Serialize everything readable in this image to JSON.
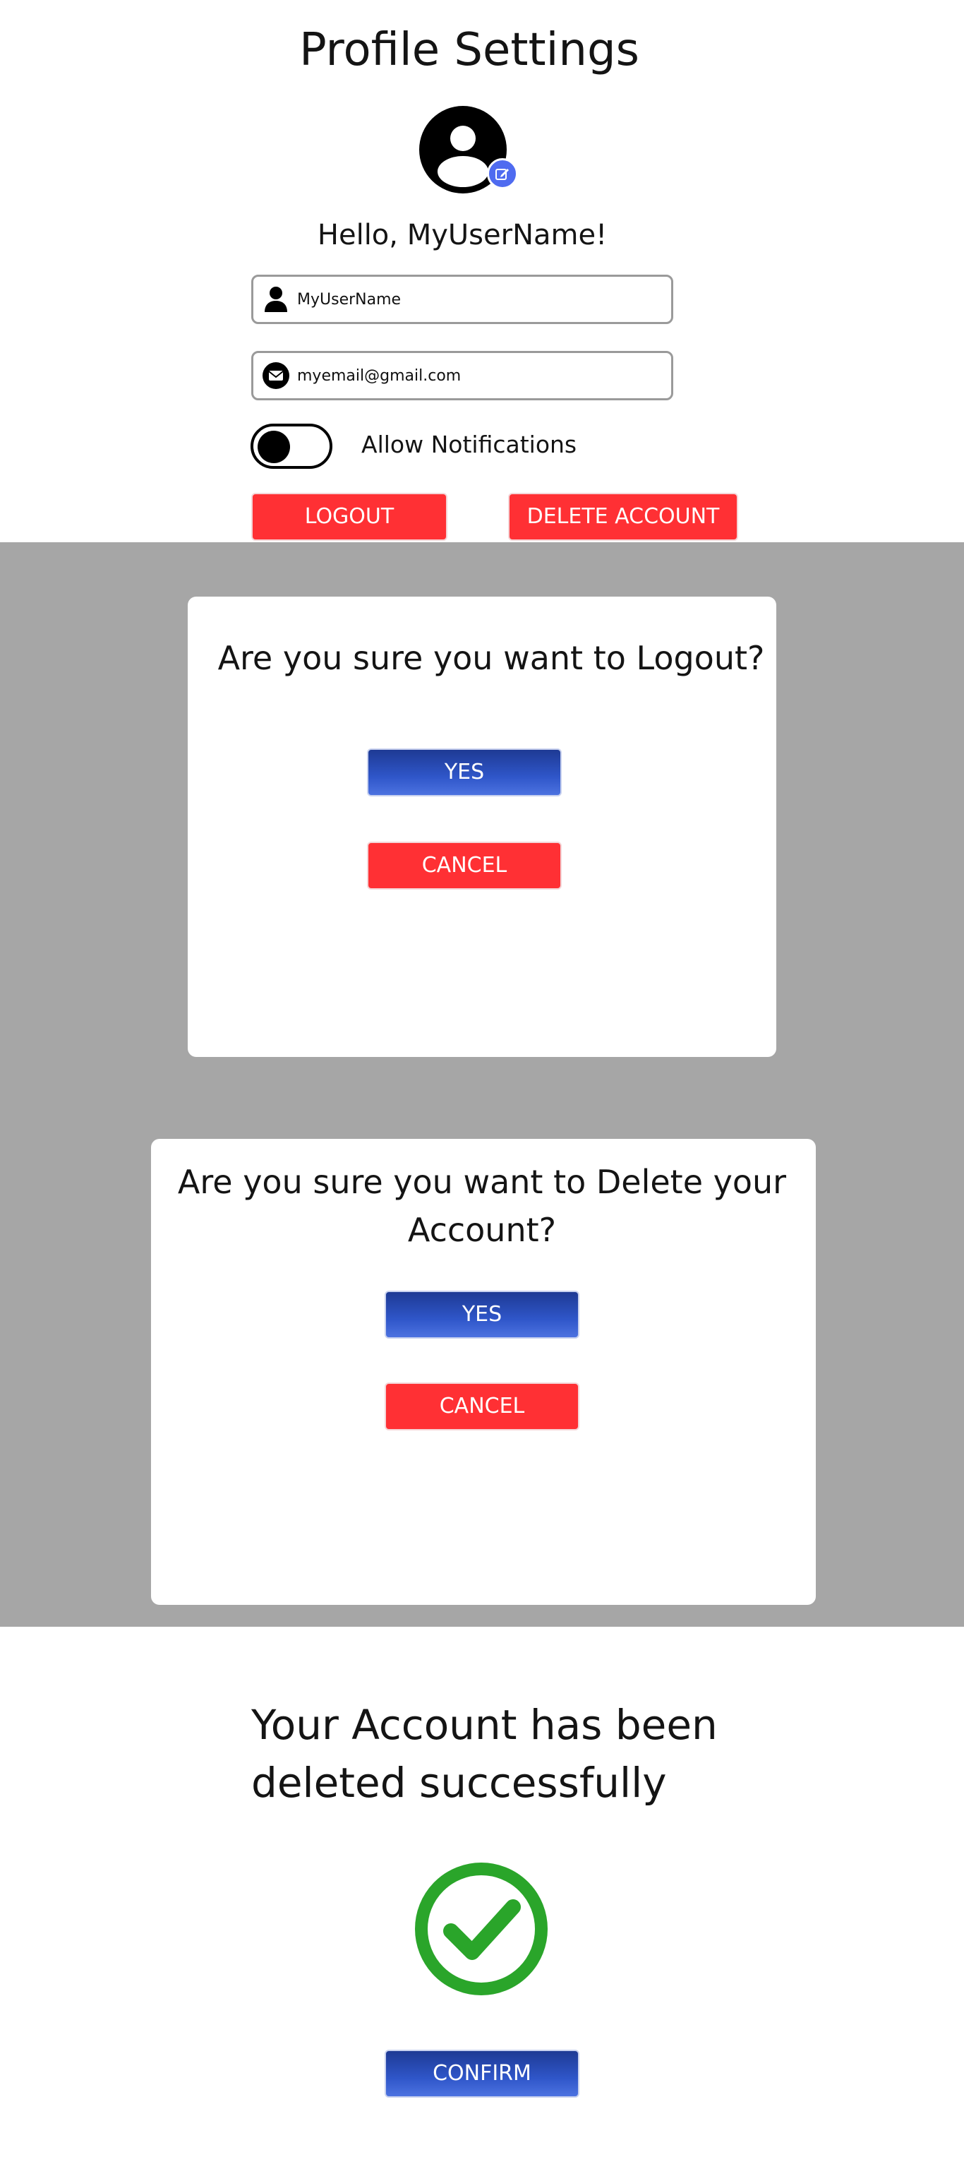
{
  "profile": {
    "title": "Profile Settings",
    "greeting": "Hello, MyUserName!",
    "username_value": "MyUserName",
    "email_value": "myemail@gmail.com",
    "notifications_label": "Allow Notifications",
    "notifications_enabled": false,
    "logout_label": "LOGOUT",
    "delete_label": "DELETE ACCOUNT",
    "icons": {
      "avatar": "user-avatar-icon",
      "edit": "edit-icon",
      "username": "person-icon",
      "email": "mail-icon"
    }
  },
  "logout_dialog": {
    "question": "Are you sure you want to Logout?",
    "yes_label": "YES",
    "cancel_label": "CANCEL"
  },
  "delete_dialog": {
    "question": "Are you sure you want to Delete your Account?",
    "yes_label": "YES",
    "cancel_label": "CANCEL"
  },
  "success": {
    "message": "Your Account has been deleted successfully",
    "icon": "check-circle-icon",
    "confirm_label": "CONFIRM"
  },
  "colors": {
    "danger": "#ff3034",
    "primary": "#2f56c9",
    "overlay": "#a6a6a6",
    "success": "#2aa52a",
    "edit_badge": "#4f6bf0"
  }
}
